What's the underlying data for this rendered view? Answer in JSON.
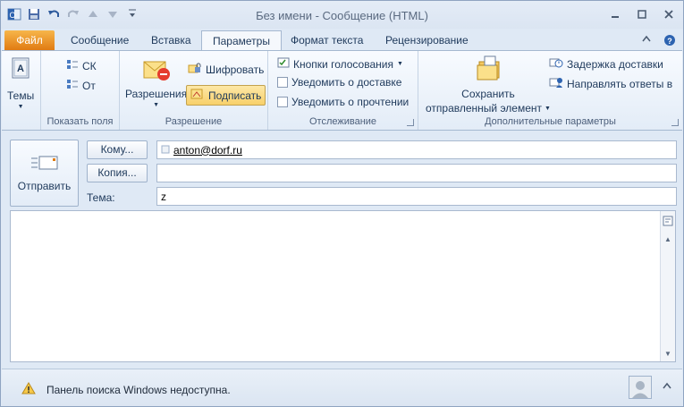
{
  "window": {
    "title": "Без имени - Сообщение (HTML)"
  },
  "tabs": [
    {
      "label": "Файл"
    },
    {
      "label": "Сообщение"
    },
    {
      "label": "Вставка"
    },
    {
      "label": "Параметры"
    },
    {
      "label": "Формат текста"
    },
    {
      "label": "Рецензирование"
    }
  ],
  "ribbon": {
    "themes": {
      "label": "Темы"
    },
    "show_fields": {
      "bcc": "СК",
      "from": "От",
      "group_label": "Показать поля"
    },
    "permission": {
      "permission": "Разрешения",
      "encrypt": "Шифровать",
      "sign": "Подписать",
      "group_label": "Разрешение"
    },
    "tracking": {
      "voting": "Кнопки голосования",
      "delivery": "Уведомить о доставке",
      "read": "Уведомить о прочтении",
      "group_label": "Отслеживание"
    },
    "more": {
      "save_sent_1": "Сохранить",
      "save_sent_2": "отправленный элемент",
      "delay": "Задержка доставки",
      "direct_replies": "Направлять ответы в",
      "group_label": "Дополнительные параметры"
    }
  },
  "header": {
    "send_label": "Отправить",
    "to_button": "Кому...",
    "cc_button": "Копия...",
    "subject_label": "Тема:",
    "to_value": "anton@dorf.ru",
    "cc_value": "",
    "subject_value": "z"
  },
  "status": {
    "message": "Панель поиска Windows недоступна."
  },
  "colors": {
    "file_tab": "#e07b12",
    "accent": "#1e395b",
    "ribbon_bg": "#e3ecf7"
  }
}
